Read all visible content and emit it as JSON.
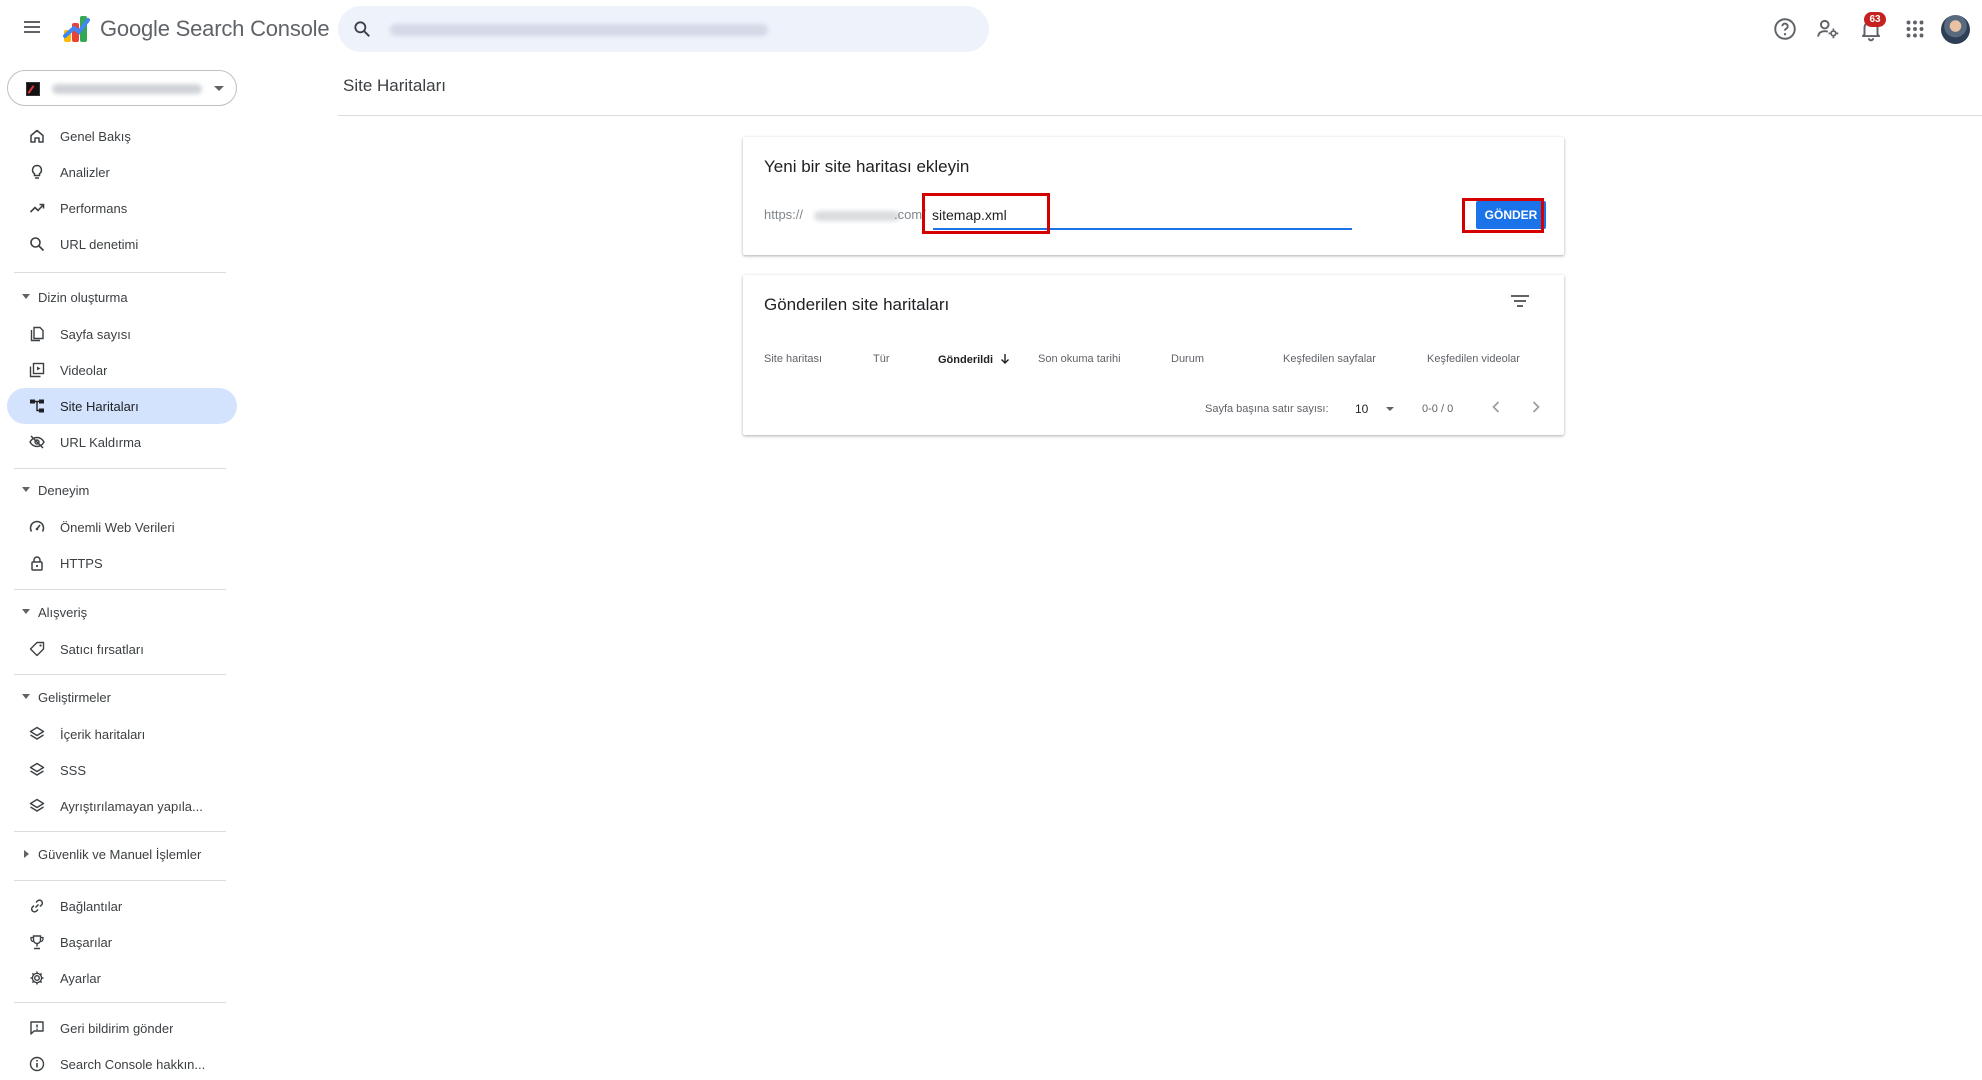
{
  "header": {
    "brand": "Google Search Console",
    "search": {
      "placeholder": "",
      "value": ""
    },
    "notifications_count": "63",
    "icons": [
      "menu-icon",
      "search-icon",
      "help-icon",
      "account-settings-icon",
      "bell-icon",
      "apps-grid-icon",
      "avatar"
    ]
  },
  "sidebar": {
    "items_top": [
      {
        "label": "Genel Bakış",
        "icon": "home-icon"
      },
      {
        "label": "Analizler",
        "icon": "lightbulb-icon"
      },
      {
        "label": "Performans",
        "icon": "trending-up-icon"
      },
      {
        "label": "URL denetimi",
        "icon": "search-icon"
      }
    ],
    "sections": [
      {
        "label": "Dizin oluşturma",
        "items": [
          {
            "label": "Sayfa sayısı",
            "icon": "pages-icon"
          },
          {
            "label": "Videolar",
            "icon": "video-library-icon"
          },
          {
            "label": "Site Haritaları",
            "icon": "sitemap-icon",
            "active": true
          },
          {
            "label": "URL Kaldırma",
            "icon": "visibility-off-icon"
          }
        ]
      },
      {
        "label": "Deneyim",
        "items": [
          {
            "label": "Önemli Web Verileri",
            "icon": "speed-icon"
          },
          {
            "label": "HTTPS",
            "icon": "lock-icon"
          }
        ]
      },
      {
        "label": "Alışveriş",
        "items": [
          {
            "label": "Satıcı fırsatları",
            "icon": "tag-icon"
          }
        ]
      },
      {
        "label": "Geliştirmeler",
        "items": [
          {
            "label": "İçerik haritaları",
            "icon": "layers-icon"
          },
          {
            "label": "SSS",
            "icon": "layers-icon"
          },
          {
            "label": "Ayrıştırılamayan yapıla...",
            "icon": "layers-icon"
          }
        ]
      },
      {
        "label": "Güvenlik ve Manuel İşlemler",
        "collapsed": true,
        "items": []
      }
    ],
    "items_bottom": [
      {
        "label": "Bağlantılar",
        "icon": "link-icon"
      },
      {
        "label": "Başarılar",
        "icon": "trophy-icon"
      },
      {
        "label": "Ayarlar",
        "icon": "gear-icon"
      }
    ],
    "items_footer": [
      {
        "label": "Geri bildirim gönder",
        "icon": "feedback-icon"
      },
      {
        "label": "Search Console hakkın...",
        "icon": "info-icon"
      }
    ]
  },
  "main": {
    "page_title": "Site Haritaları",
    "add_card": {
      "title": "Yeni bir site haritası ekleyin",
      "prefix_start": "https://",
      "prefix_end": ".com/",
      "input_value": "sitemap.xml",
      "submit_label": "GÖNDER"
    },
    "submitted_card": {
      "title": "Gönderilen site haritaları",
      "columns": [
        "Site haritası",
        "Tür",
        "Gönderildi",
        "Son okuma tarihi",
        "Durum",
        "Keşfedilen sayfalar",
        "Keşfedilen videolar"
      ],
      "sorted_column": "Gönderildi",
      "rows": [],
      "pager": {
        "rows_per_page_label": "Sayfa başına satır sayısı:",
        "rows_per_page": "10",
        "range": "0-0 / 0"
      }
    }
  },
  "colors": {
    "accent": "#1a73e8",
    "active_nav": "#d3e3fd",
    "highlight_box": "#d50000",
    "badge": "#c5221f"
  }
}
